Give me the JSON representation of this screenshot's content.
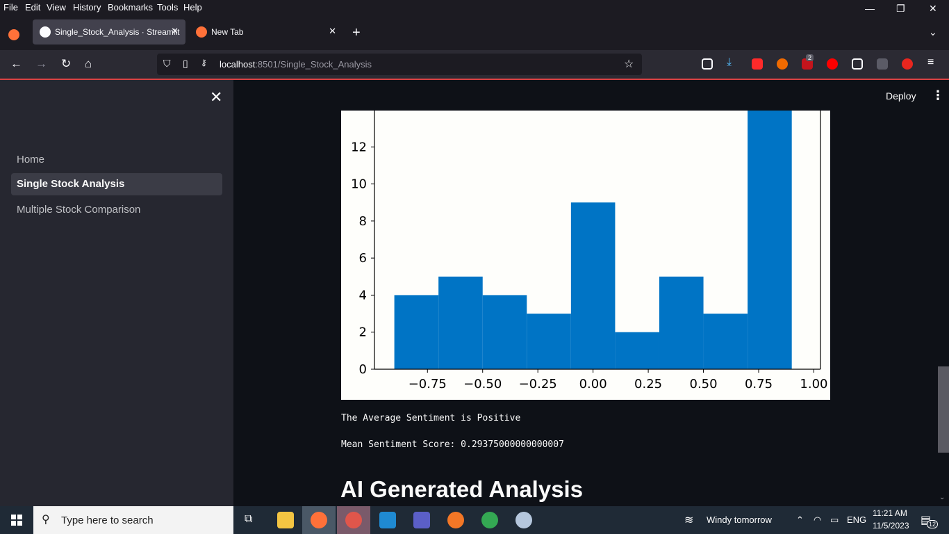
{
  "browser": {
    "menu": [
      "File",
      "Edit",
      "View",
      "History",
      "Bookmarks",
      "Tools",
      "Help"
    ],
    "tabs": [
      {
        "label": "Single_Stock_Analysis · Streamlit"
      },
      {
        "label": "New Tab"
      }
    ],
    "url": {
      "host": "localhost",
      "path": ":8501/Single_Stock_Analysis"
    },
    "download_badge": "2"
  },
  "app": {
    "deploy_label": "Deploy",
    "sidebar": {
      "items": [
        {
          "label": "Home",
          "active": false
        },
        {
          "label": "Single Stock Analysis",
          "active": true
        },
        {
          "label": "Multiple Stock Comparison",
          "active": false
        }
      ]
    },
    "average_sentiment": "The Average Sentiment is Positive",
    "mean_score": "Mean Sentiment Score: 0.29375000000000007",
    "section_heading": "AI Generated Analysis"
  },
  "chart_data": {
    "type": "bar",
    "subtype": "histogram",
    "bin_edges": [
      -0.9,
      -0.7,
      -0.5,
      -0.3,
      -0.1,
      0.1,
      0.3,
      0.5,
      0.7,
      0.9
    ],
    "values": [
      4,
      5,
      4,
      3,
      9,
      2,
      5,
      3,
      14
    ],
    "xlim": [
      -0.99,
      1.03
    ],
    "ylim": [
      0,
      14
    ],
    "xticks": [
      "−0.75",
      "−0.50",
      "−0.25",
      "0.00",
      "0.25",
      "0.50",
      "0.75",
      "1.00"
    ],
    "yticks": [
      "0",
      "2",
      "4",
      "6",
      "8",
      "10",
      "12"
    ],
    "bar_color": "#0074c5"
  },
  "taskbar": {
    "search_placeholder": "Type here to search",
    "weather": "Windy tomorrow",
    "lang": "ENG",
    "time": "11:21 AM",
    "date": "11/5/2023",
    "notifications": "12"
  }
}
